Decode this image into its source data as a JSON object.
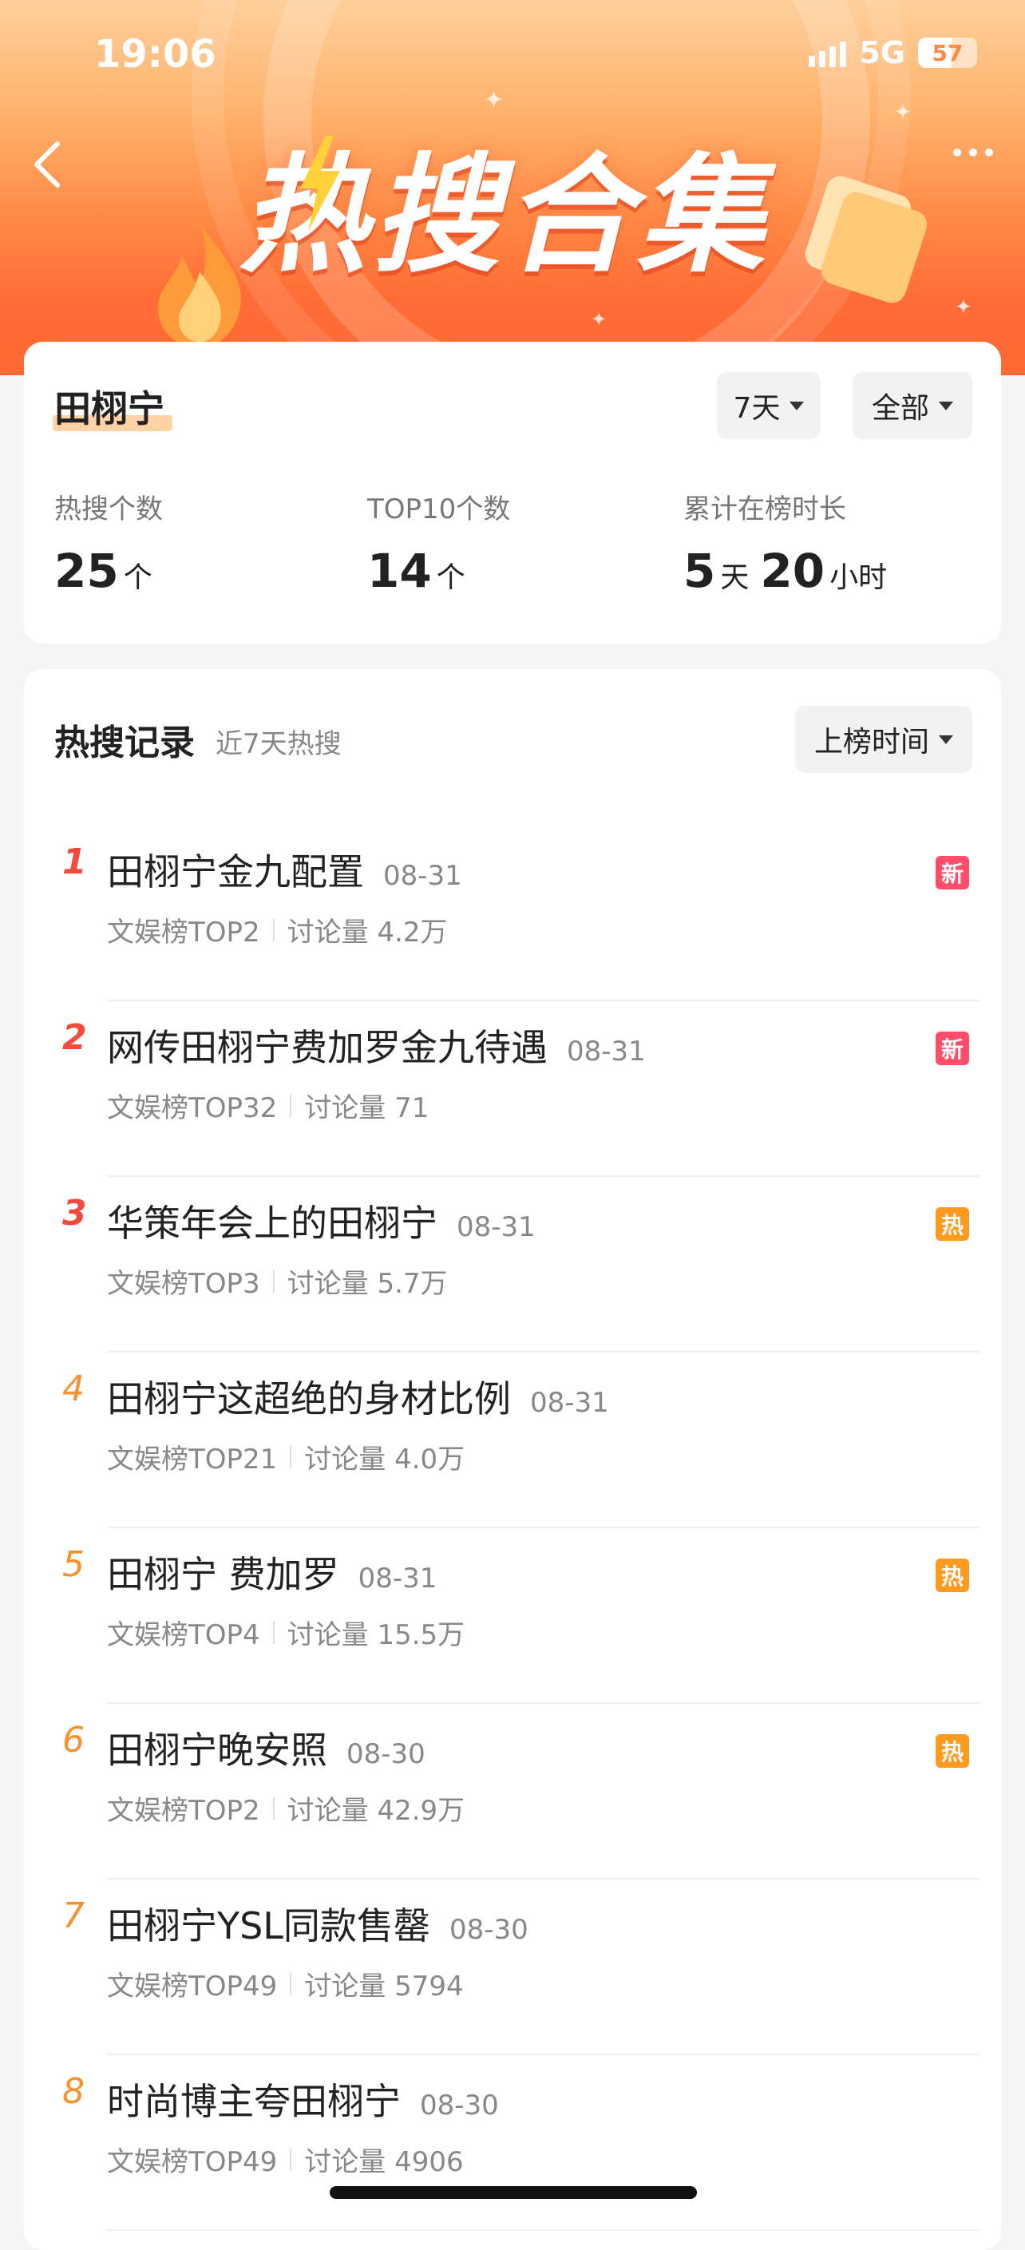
{
  "status": {
    "time": "19:06",
    "network": "5G",
    "battery": "57"
  },
  "header": {
    "title": "热搜合集"
  },
  "summary": {
    "name": "田栩宁",
    "filter_period": "7天",
    "filter_type": "全部",
    "stats": [
      {
        "label": "热搜个数",
        "value": "25",
        "unit": "个"
      },
      {
        "label": "TOP10个数",
        "value": "14",
        "unit": "个"
      },
      {
        "label": "累计在榜时长",
        "value1": "5",
        "unit1": "天",
        "value2": "20",
        "unit2": "小时"
      }
    ]
  },
  "records": {
    "title": "热搜记录",
    "subtitle": "近7天热搜",
    "sort_label": "上榜时间",
    "items": [
      {
        "rank": "1",
        "title": "田栩宁金九配置",
        "date": "08-31",
        "board": "文娱榜TOP2",
        "discussion": "讨论量 4.2万",
        "badge": "新"
      },
      {
        "rank": "2",
        "title": "网传田栩宁费加罗金九待遇",
        "date": "08-31",
        "board": "文娱榜TOP32",
        "discussion": "讨论量 71",
        "badge": "新"
      },
      {
        "rank": "3",
        "title": "华策年会上的田栩宁",
        "date": "08-31",
        "board": "文娱榜TOP3",
        "discussion": "讨论量 5.7万",
        "badge": "热"
      },
      {
        "rank": "4",
        "title": "田栩宁这超绝的身材比例",
        "date": "08-31",
        "board": "文娱榜TOP21",
        "discussion": "讨论量 4.0万",
        "badge": ""
      },
      {
        "rank": "5",
        "title": "田栩宁 费加罗",
        "date": "08-31",
        "board": "文娱榜TOP4",
        "discussion": "讨论量 15.5万",
        "badge": "热"
      },
      {
        "rank": "6",
        "title": "田栩宁晚安照",
        "date": "08-30",
        "board": "文娱榜TOP2",
        "discussion": "讨论量 42.9万",
        "badge": "热"
      },
      {
        "rank": "7",
        "title": "田栩宁YSL同款售罄",
        "date": "08-30",
        "board": "文娱榜TOP49",
        "discussion": "讨论量 5794",
        "badge": ""
      },
      {
        "rank": "8",
        "title": "时尚博主夸田栩宁",
        "date": "08-30",
        "board": "文娱榜TOP49",
        "discussion": "讨论量 4906",
        "badge": ""
      }
    ]
  },
  "colors": {
    "accent_red": "#f24a3d",
    "accent_orange": "#f7912e",
    "badge_new": "#ff4e6a",
    "badge_hot": "#ff9a1f"
  }
}
